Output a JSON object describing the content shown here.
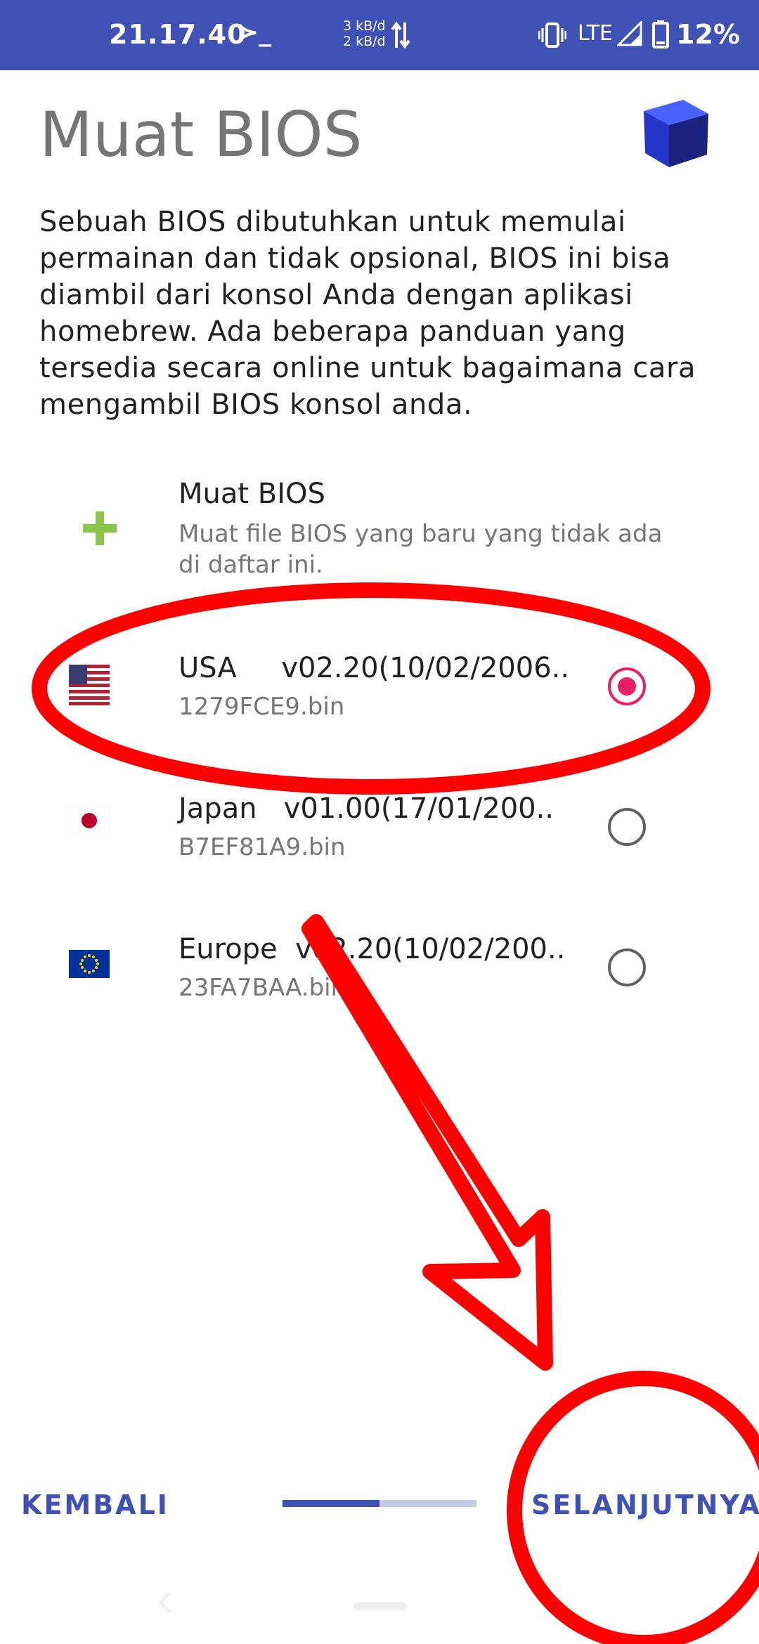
{
  "status_bar": {
    "time": "21.17.40",
    "prompt_glyph": "≻_",
    "net_up": "3 kB/d",
    "net_down": "2 kB/d",
    "network": "LTE",
    "battery": "12%",
    "background": "#3f51b5"
  },
  "header": {
    "title": "Muat BIOS",
    "logo_icon": "cube-icon",
    "description": "Sebuah BIOS dibutuhkan untuk memulai permainan dan tidak opsional, BIOS ini bisa diambil dari konsol Anda dengan aplikasi homebrew. Ada beberapa panduan yang tersedia secara online untuk bagaimana cara mengambil BIOS konsol anda."
  },
  "load_bios_item": {
    "icon": "plus-icon",
    "title": "Muat BIOS",
    "subtitle": "Muat file BIOS yang baru yang tidak ada di daftar ini."
  },
  "bios_list": [
    {
      "region": "USA",
      "title": "USA     v02.20(10/02/2006..",
      "file": "1279FCE9.bin",
      "icon": "usa-flag-icon",
      "selected": true
    },
    {
      "region": "Japan",
      "title": "Japan   v01.00(17/01/200..",
      "file": "B7EF81A9.bin",
      "icon": "japan-flag-icon",
      "selected": false
    },
    {
      "region": "Europe",
      "title": "Europe  v02.20(10/02/200..",
      "file": "23FA7BAA.bin",
      "icon": "eu-flag-icon",
      "selected": false
    }
  ],
  "footer": {
    "back_label": "KEMBALI",
    "next_label": "SELANJUTNYA",
    "progress": 0.5,
    "accent": "#3f51b5"
  },
  "colors": {
    "radio_selected": "#e91e63",
    "plus_icon": "#8bc34a",
    "annotation": "#ff0000"
  }
}
